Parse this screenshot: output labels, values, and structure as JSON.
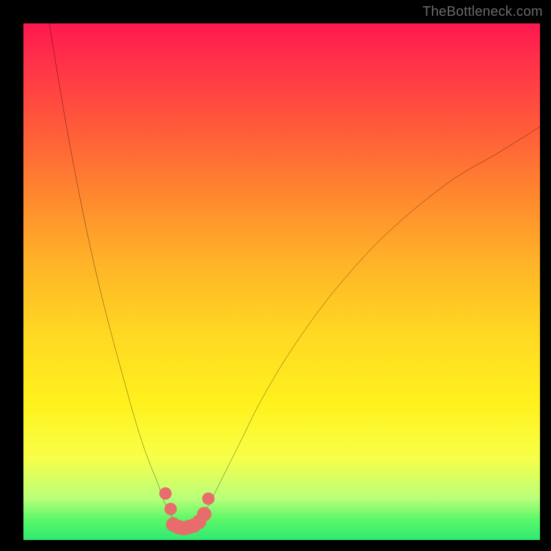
{
  "watermark": "TheBottleneck.com",
  "chart_data": {
    "type": "line",
    "title": "",
    "xlabel": "",
    "ylabel": "",
    "xlim": [
      0,
      100
    ],
    "ylim": [
      0,
      100
    ],
    "grid": false,
    "legend": false,
    "series": [
      {
        "name": "left-curve",
        "x": [
          5,
          8,
          11,
          14,
          17,
          20,
          22,
          24,
          26,
          27,
          28,
          29
        ],
        "y": [
          100,
          82,
          66,
          52,
          40,
          29,
          22,
          16,
          11,
          8,
          6,
          4
        ]
      },
      {
        "name": "right-curve",
        "x": [
          34,
          36,
          38,
          42,
          46,
          52,
          60,
          70,
          82,
          92,
          100
        ],
        "y": [
          4,
          7,
          11,
          19,
          27,
          37,
          48,
          59,
          69,
          75,
          80
        ]
      },
      {
        "name": "floor-band",
        "x": [
          28,
          31,
          34
        ],
        "y": [
          3,
          2,
          3
        ]
      }
    ],
    "markers": [
      {
        "x": 27.5,
        "y": 9.0,
        "r": 1.2
      },
      {
        "x": 28.5,
        "y": 6.0,
        "r": 1.2
      },
      {
        "x": 29.0,
        "y": 3.0,
        "r": 1.4
      },
      {
        "x": 30.0,
        "y": 2.5,
        "r": 1.4
      },
      {
        "x": 31.0,
        "y": 2.3,
        "r": 1.4
      },
      {
        "x": 32.0,
        "y": 2.5,
        "r": 1.4
      },
      {
        "x": 33.0,
        "y": 2.8,
        "r": 1.4
      },
      {
        "x": 34.0,
        "y": 3.5,
        "r": 1.4
      },
      {
        "x": 35.0,
        "y": 5.0,
        "r": 1.4
      },
      {
        "x": 35.8,
        "y": 8.0,
        "r": 1.2
      }
    ],
    "marker_color": "#e86c6c",
    "curve_color": "#000000",
    "floor_color": "#e86c6c"
  }
}
